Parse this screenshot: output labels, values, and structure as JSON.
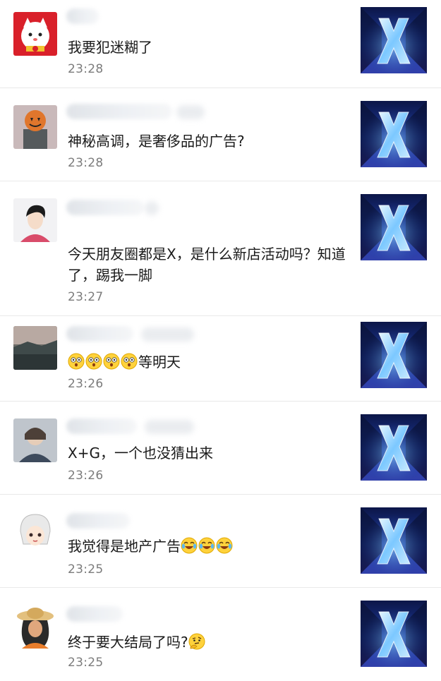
{
  "comments": [
    {
      "name": "",
      "text": "我要犯迷糊了",
      "time": "23:28"
    },
    {
      "name": "",
      "text": "神秘高调，是奢侈品的广告?",
      "time": "23:28"
    },
    {
      "name": "",
      "text": "今天朋友圈都是X，是什么新店活动吗？知道了，踢我一脚",
      "time": "23:27"
    },
    {
      "name": "",
      "text": "等明天",
      "time": "23:26"
    },
    {
      "name": "",
      "text": "X+G，一个也没猜出来",
      "time": "23:26"
    },
    {
      "name": "",
      "text": "我觉得是地产广告",
      "time": "23:25"
    },
    {
      "name": "",
      "text": "终于要大结局了吗?",
      "time": "23:25"
    }
  ],
  "icons": {
    "thumbnail": "x-poster-thumbnail",
    "shocked": "shocked-face-emoji",
    "crying": "crying-laughing-emoji",
    "thinking": "thinking-face-emoji"
  },
  "colors": {
    "text": "#1a1a1a",
    "time": "#7c7c7c",
    "divider": "#e9e9e9",
    "poster": "#1a2d7a"
  }
}
